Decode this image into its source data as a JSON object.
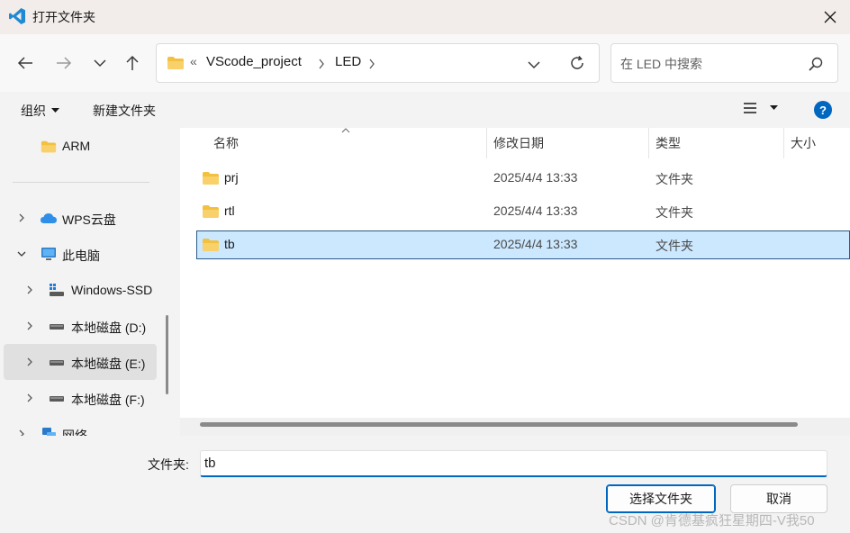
{
  "window": {
    "title": "打开文件夹"
  },
  "address_bar": {
    "overflow_chevron": "«",
    "crumbs": [
      "VScode_project",
      "LED"
    ]
  },
  "search": {
    "placeholder": "在 LED 中搜索"
  },
  "toolbar": {
    "organize_label": "组织",
    "new_folder_label": "新建文件夹"
  },
  "sidebar": {
    "items": [
      {
        "label": "ARM",
        "icon": "folder-icon"
      },
      {
        "label": "WPS云盘",
        "icon": "cloud-icon"
      },
      {
        "label": "此电脑",
        "icon": "computer-icon"
      },
      {
        "label": "Windows-SSD",
        "icon": "windows-drive-icon"
      },
      {
        "label": "本地磁盘 (D:)",
        "icon": "drive-icon"
      },
      {
        "label": "本地磁盘 (E:)",
        "icon": "drive-icon"
      },
      {
        "label": "本地磁盘 (F:)",
        "icon": "drive-icon"
      },
      {
        "label": "网络",
        "icon": "network-icon"
      }
    ]
  },
  "file_list": {
    "columns": [
      "名称",
      "修改日期",
      "类型",
      "大小"
    ],
    "rows": [
      {
        "name": "prj",
        "date": "2025/4/4 13:33",
        "type": "文件夹"
      },
      {
        "name": "rtl",
        "date": "2025/4/4 13:33",
        "type": "文件夹"
      },
      {
        "name": "tb",
        "date": "2025/4/4 13:33",
        "type": "文件夹"
      }
    ]
  },
  "bottom": {
    "folder_label": "文件夹:",
    "folder_value": "tb",
    "select_button": "选择文件夹",
    "cancel_button": "取消"
  },
  "watermark": "CSDN @肯德基疯狂星期四-V我50",
  "colors": {
    "accent": "#0067c0",
    "selection": "#cce8ff",
    "folder": "#f3c03f"
  }
}
